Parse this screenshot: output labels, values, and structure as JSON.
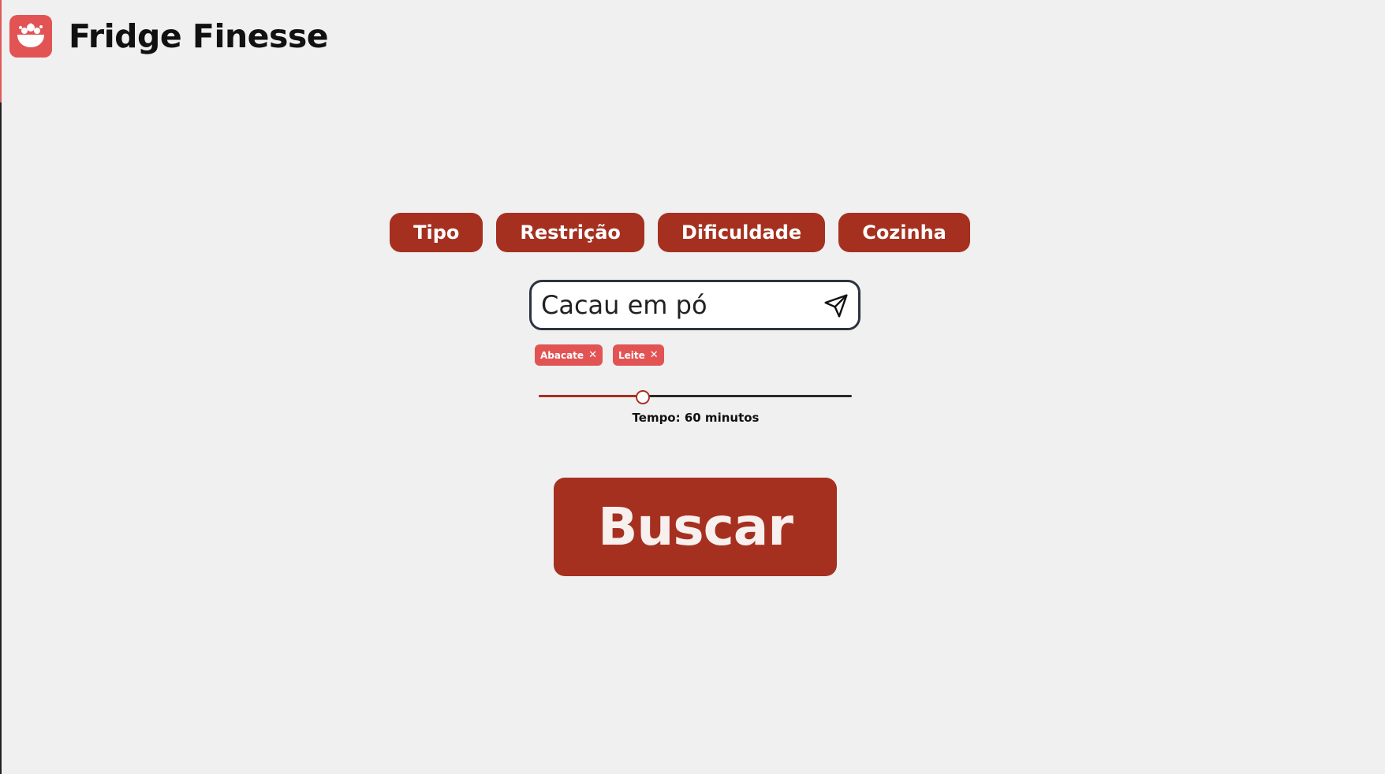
{
  "app": {
    "title": "Fridge Finesse",
    "logo_icon": "bowl-icon",
    "brand_color": "#e25454",
    "accent_color": "#a63020"
  },
  "filters": [
    {
      "label": "Tipo"
    },
    {
      "label": "Restrição"
    },
    {
      "label": "Dificuldade"
    },
    {
      "label": "Cozinha"
    }
  ],
  "search": {
    "value": "Cacau em pó",
    "send_icon": "send-icon"
  },
  "ingredients": [
    {
      "label": "Abacate",
      "remove_icon": "close-icon"
    },
    {
      "label": "Leite",
      "remove_icon": "close-icon"
    }
  ],
  "time": {
    "label": "Tempo: 60 minutos",
    "slider_fraction": 0.33
  },
  "actions": {
    "search_label": "Buscar"
  }
}
